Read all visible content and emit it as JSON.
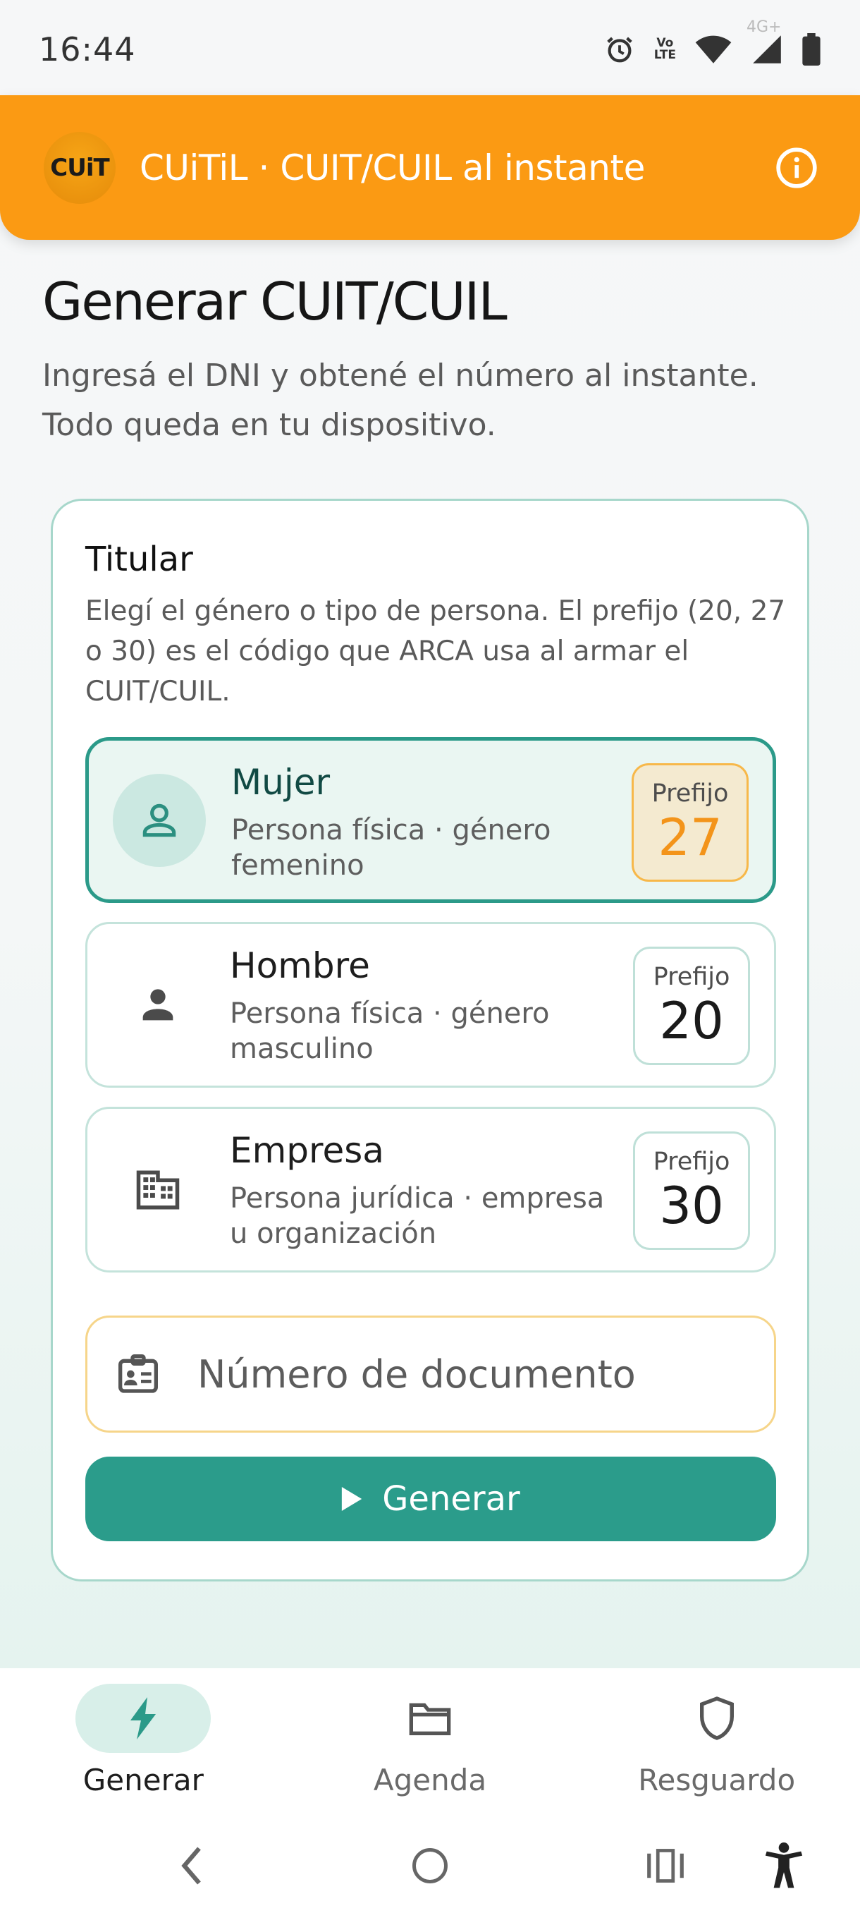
{
  "status_bar": {
    "time": "16:44",
    "network_label": "4G+",
    "volte_label_top": "Vo",
    "volte_label_bottom": "LTE"
  },
  "app_bar": {
    "logo_text": "CUiT",
    "title": "CUiTiL · CUIT/CUIL al instante",
    "info_icon": "info-icon"
  },
  "header": {
    "title": "Generar CUIT/CUIL",
    "subtitle": "Ingresá el DNI y obtené el número al instante. Todo queda en tu dispositivo."
  },
  "card": {
    "title": "Titular",
    "description": "Elegí el género o tipo de persona. El prefijo (20, 27 o 30) es el código que ARCA usa al armar el CUIT/CUIL.",
    "options": [
      {
        "name": "Mujer",
        "description": "Persona física · género femenino",
        "prefix_label": "Prefijo",
        "prefix": "27",
        "icon": "person-outline-icon",
        "selected": true
      },
      {
        "name": "Hombre",
        "description": "Persona física · género masculino",
        "prefix_label": "Prefijo",
        "prefix": "20",
        "icon": "person-icon",
        "selected": false
      },
      {
        "name": "Empresa",
        "description": "Persona jurídica · empresa u organización",
        "prefix_label": "Prefijo",
        "prefix": "30",
        "icon": "building-icon",
        "selected": false
      }
    ],
    "document_input": {
      "placeholder": "Número de documento",
      "value": "",
      "icon": "id-badge-icon"
    },
    "generate_button": {
      "label": "Generar",
      "icon": "play-icon"
    }
  },
  "bottom_nav": {
    "items": [
      {
        "label": "Generar",
        "icon": "bolt-icon",
        "active": true
      },
      {
        "label": "Agenda",
        "icon": "folder-icon",
        "active": false
      },
      {
        "label": "Resguardo",
        "icon": "shield-icon",
        "active": false
      }
    ]
  },
  "colors": {
    "accent_orange": "#fb9a13",
    "primary_teal": "#2b9c8b",
    "selected_bg": "#eaf6f2",
    "prefix_highlight": "#f3941a"
  }
}
